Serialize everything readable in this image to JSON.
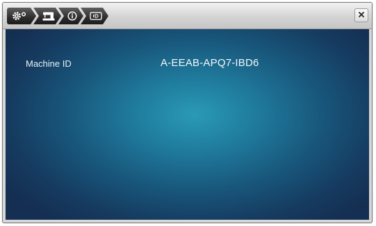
{
  "toolbar": {
    "crumbs": [
      {
        "icon": "settings-icon"
      },
      {
        "icon": "sewing-machine-icon"
      },
      {
        "icon": "info-icon"
      },
      {
        "icon": "id-card-icon"
      }
    ],
    "close_icon": "close-icon",
    "close_label": "×"
  },
  "main": {
    "machine_id_label": "Machine ID",
    "machine_id_value": "A-EEAB-APQ7-IBD6"
  },
  "colors": {
    "panel_center": "#2a9ab6",
    "panel_edge": "#142f52",
    "toolbar_dark": "#2d2d2d"
  }
}
